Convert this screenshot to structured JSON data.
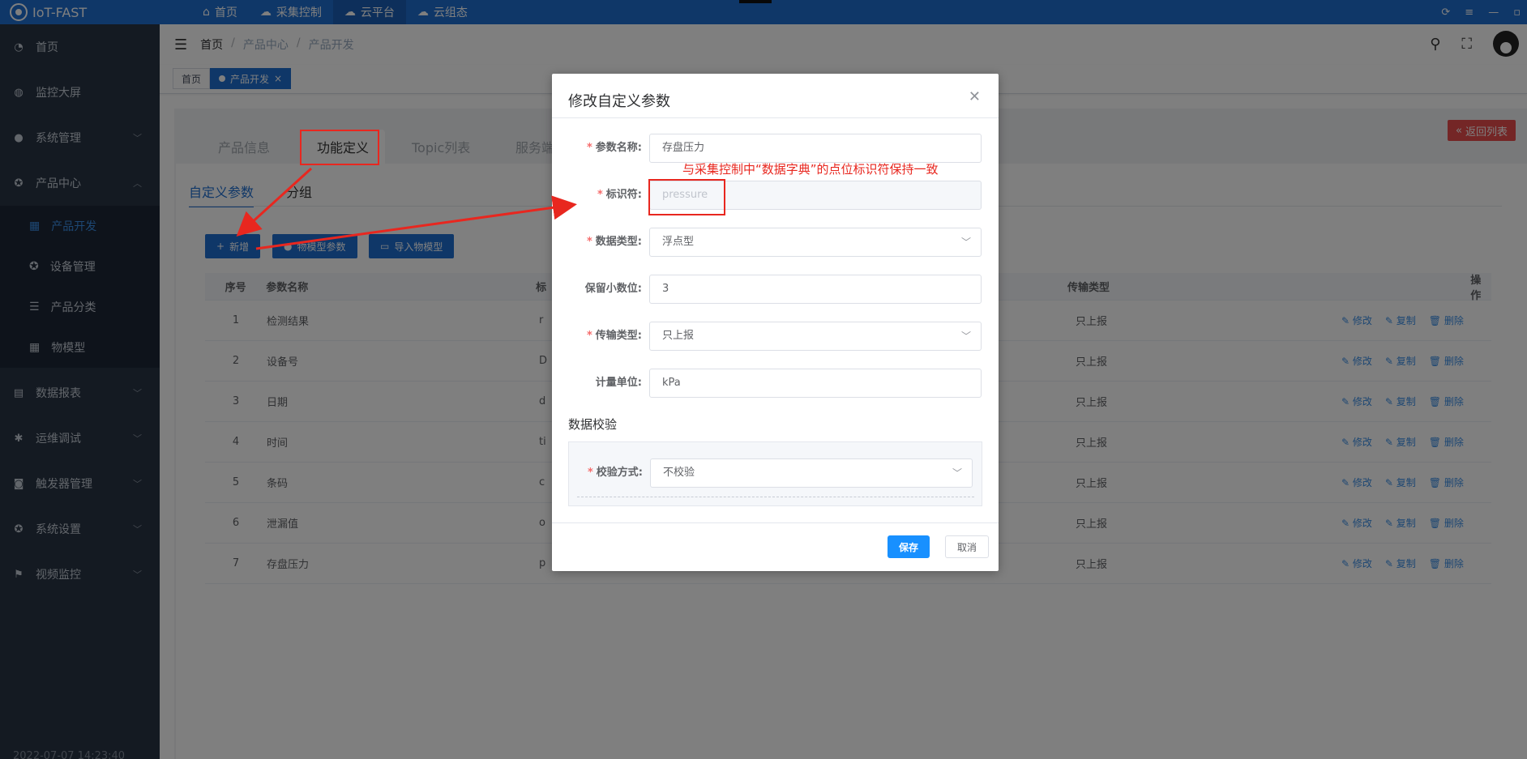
{
  "app": {
    "title": "IoT-FAST"
  },
  "topnav": [
    {
      "label": "首页",
      "icon": "home-icon"
    },
    {
      "label": "采集控制",
      "icon": "cloud-control-icon"
    },
    {
      "label": "云平台",
      "icon": "cloud-platform-icon"
    },
    {
      "label": "云组态",
      "icon": "cloud-config-icon"
    }
  ],
  "window_controls": [
    "refresh-icon",
    "menu-icon",
    "minimize-icon",
    "restore-icon"
  ],
  "sidebar": {
    "items": [
      {
        "label": "首页",
        "icon": "dashboard-icon"
      },
      {
        "label": "监控大屏",
        "icon": "globe-icon"
      },
      {
        "label": "系统管理",
        "icon": "user-icon"
      },
      {
        "label": "产品中心",
        "icon": "gear-icon"
      },
      {
        "label": "数据报表",
        "icon": "report-icon"
      },
      {
        "label": "运维调试",
        "icon": "bug-icon"
      },
      {
        "label": "触发器管理",
        "icon": "trigger-icon"
      },
      {
        "label": "系统设置",
        "icon": "settings-icon"
      },
      {
        "label": "视频监控",
        "icon": "video-icon"
      }
    ],
    "subitems": [
      {
        "label": "产品开发",
        "icon": "calendar-icon"
      },
      {
        "label": "设备管理",
        "icon": "device-icon"
      },
      {
        "label": "产品分类",
        "icon": "list-icon"
      },
      {
        "label": "物模型",
        "icon": "grid-icon"
      }
    ],
    "time": "2022-07-07 14:23:40"
  },
  "breadcrumb": [
    "首页",
    "产品中心",
    "产品开发"
  ],
  "tags": {
    "home": "首页",
    "active": "产品开发"
  },
  "product_tabs": [
    "产品信息",
    "功能定义",
    "Topic列表",
    "服务端"
  ],
  "sub_tabs": [
    "自定义参数",
    "分组"
  ],
  "back_button": "返回列表",
  "buttons": {
    "add": "新增",
    "model_params": "物模型参数",
    "import_model": "导入物模型"
  },
  "table": {
    "headers": {
      "no": "序号",
      "name": "参数名称",
      "trans": "传输类型",
      "ops": "操作"
    },
    "ops": {
      "edit": "修改",
      "copy": "复制",
      "delete": "删除"
    },
    "rows": [
      {
        "no": "1",
        "name": "检测结果",
        "id": "r",
        "trans": "只上报"
      },
      {
        "no": "2",
        "name": "设备号",
        "id": "D",
        "trans": "只上报"
      },
      {
        "no": "3",
        "name": "日期",
        "id": "d",
        "trans": "只上报"
      },
      {
        "no": "4",
        "name": "时间",
        "id": "ti",
        "trans": "只上报"
      },
      {
        "no": "5",
        "name": "条码",
        "id": "c",
        "trans": "只上报"
      },
      {
        "no": "6",
        "name": "泄漏值",
        "id": "o",
        "trans": "只上报"
      },
      {
        "no": "7",
        "name": "存盘压力",
        "id": "p",
        "trans": "只上报"
      }
    ]
  },
  "dialog": {
    "title": "修改自定义参数",
    "fields": {
      "name": {
        "label": "参数名称:",
        "value": "存盘压力"
      },
      "identifier": {
        "label": "标识符:",
        "value": "pressure"
      },
      "data_type": {
        "label": "数据类型:",
        "value": "浮点型"
      },
      "decimals": {
        "label": "保留小数位:",
        "value": "3"
      },
      "transfer": {
        "label": "传输类型:",
        "value": "只上报"
      },
      "unit": {
        "label": "计量单位:",
        "value": "kPa"
      }
    },
    "verify_section": "数据校验",
    "verify": {
      "label": "校验方式:",
      "value": "不校验"
    },
    "save": "保存",
    "cancel": "取消"
  },
  "annotation": "与采集控制中“数据字典”的点位标识符保持一致",
  "colors": {
    "brand": "#1f6fd1",
    "sidebar": "#283444",
    "annotation": "#e8271f",
    "primary": "#1890ff"
  }
}
